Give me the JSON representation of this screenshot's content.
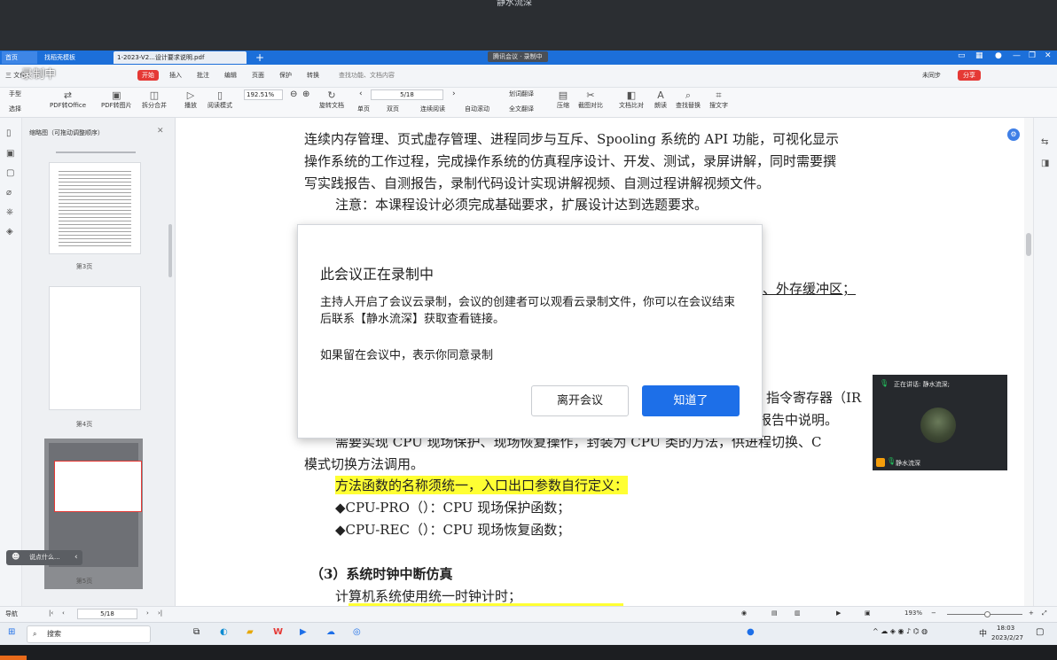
{
  "top_label": "静水流深",
  "titlebar": {
    "tabs": [
      "首页",
      "找稻壳模板",
      "1-2023-V2...设计要求说明.pdf"
    ],
    "add_tab": "+",
    "meeting_badge": "腾讯会议 · 录制中"
  },
  "menubar": {
    "file": "三 文件",
    "recording_overlay": "录制中",
    "items": [
      "开始",
      "插入",
      "批注",
      "编辑",
      "页面",
      "保护",
      "转换"
    ],
    "search": "查找功能、文档内容",
    "sync": "未同步",
    "share": "分享"
  },
  "ribbon": {
    "hand": "手型",
    "select": "选择",
    "pdf_to_office": "PDF转Office",
    "pdf_to_image": "PDF转图片",
    "split_merge": "拆分合并",
    "play": "播放",
    "read_mode": "阅读模式",
    "zoom": "192.51%",
    "rotate": "旋转文档",
    "page": "5/18",
    "single": "单页",
    "double": "双页",
    "continuous": "连续阅读",
    "auto_scroll": "自动滚动",
    "translate": "划词翻译",
    "full_translate": "全文翻译",
    "compress": "压缩",
    "screen_compare": "截图对比",
    "doc_compare": "文档比对",
    "read_aloud": "朗读",
    "find_replace": "查找替换",
    "find_text": "搜文字"
  },
  "thumb_panel": {
    "header": "缩略图（可拖动调整顺序）",
    "pages": [
      "第3页",
      "第4页",
      "第5页"
    ],
    "tooltip": "说点什么..."
  },
  "document": {
    "lines": [
      "连续内存管理、页式虚存管理、进程同步与互斥、Spooling 系统的 API 功能，可视化显示",
      "操作系统的工作过程，完成操作系统的仿真程序设计、开发、测试，录屏讲解，同时需要撰",
      "写实践报告、自测报告，录制代码设计实现讲解视频、自测过程讲解视频文件。",
      "注意：本课程设计必须完成基础要求，扩展设计达到选题要求。",
      "、外存缓冲区；",
      "指令寄存器（IR",
      "报告中说明。",
      "需要实现 CPU 现场保护、现场恢复操作，封装为 CPU 类的方法，供进程切换、C",
      "模式切换方法调用。",
      "方法函数的名称须统一，入口出口参数自行定义：",
      "◆CPU-PRO（）：CPU 现场保护函数；",
      "◆CPU-REC（）：CPU 现场恢复函数；",
      "（3）系统时钟中断仿真",
      "计算机系统使用统一时钟计时；"
    ]
  },
  "dialog": {
    "title": "此会议正在录制中",
    "body": "主持人开启了会议云录制，会议的创建者可以观看云录制文件，你可以在会议结束后联系【静水流深】获取查看链接。",
    "note": "如果留在会议中，表示你同意录制",
    "leave": "离开会议",
    "ok": "知道了"
  },
  "video": {
    "speaking": "正在讲话: 静水流深;",
    "name": "静水流深"
  },
  "statusbar": {
    "nav": "导航",
    "page": "5/18",
    "zoom": "193%"
  },
  "taskbar": {
    "search": "搜索",
    "ime": "中",
    "time": "18:03",
    "date": "2023/2/27"
  }
}
